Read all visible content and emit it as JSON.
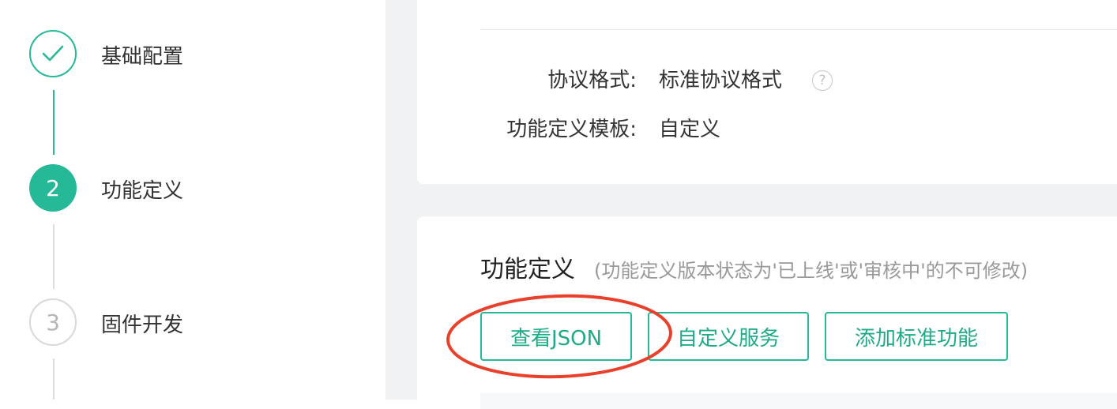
{
  "steps": [
    {
      "number": "",
      "label": "基础配置",
      "state": "done"
    },
    {
      "number": "2",
      "label": "功能定义",
      "state": "active"
    },
    {
      "number": "3",
      "label": "固件开发",
      "state": "pending"
    }
  ],
  "info": {
    "protocol_label": "协议格式:",
    "protocol_value": "标准协议格式",
    "template_label": "功能定义模板:",
    "template_value": "自定义"
  },
  "function_section": {
    "title": "功能定义",
    "note": "(功能定义版本状态为'已上线'或'审核中'的不可修改)",
    "buttons": {
      "view_json": "查看JSON",
      "custom_service": "自定义服务",
      "add_standard": "添加标准功能"
    }
  },
  "colors": {
    "accent": "#26b997",
    "annotation": "#e8402a"
  },
  "icons": {
    "step1": "check-icon",
    "help": "question-circle-icon"
  }
}
